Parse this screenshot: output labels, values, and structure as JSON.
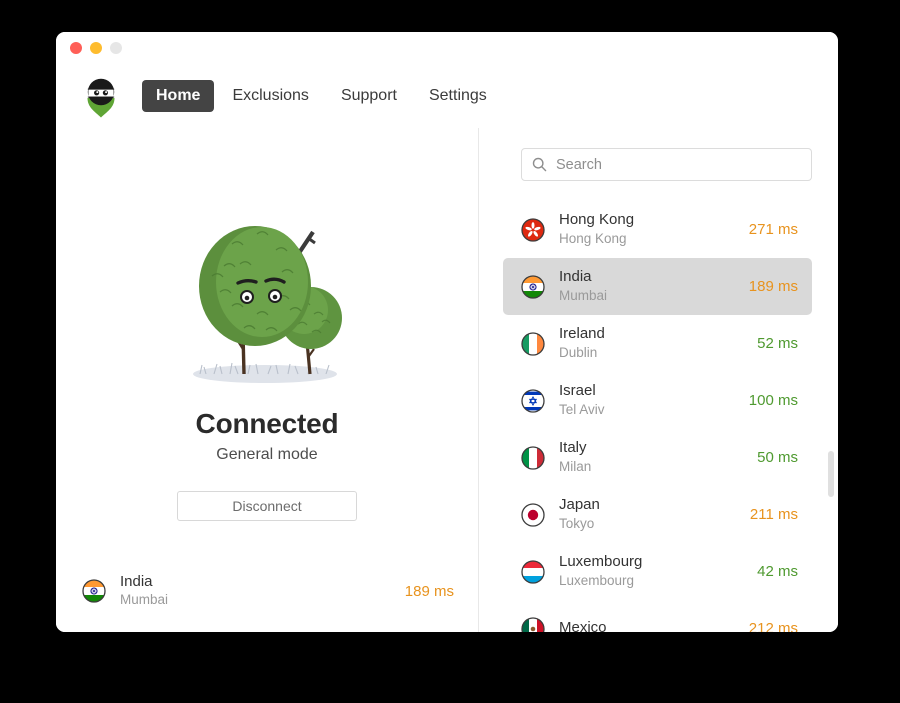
{
  "window": {
    "traffic_lights": [
      "close",
      "minimize",
      "maximize"
    ]
  },
  "nav": {
    "logo_name": "ninja-logo",
    "items": [
      {
        "label": "Home",
        "active": true
      },
      {
        "label": "Exclusions",
        "active": false
      },
      {
        "label": "Support",
        "active": false
      },
      {
        "label": "Settings",
        "active": false
      }
    ]
  },
  "connection": {
    "illustration_name": "ninja-bush-illustration",
    "status": "Connected",
    "mode": "General mode",
    "button_label": "Disconnect",
    "current_server": {
      "country": "India",
      "city": "Mumbai",
      "ping": "189 ms",
      "ping_level": "high",
      "flag": "flag-in"
    }
  },
  "search": {
    "placeholder": "Search",
    "value": "",
    "icon": "search-icon"
  },
  "servers": [
    {
      "country": "Hong Kong",
      "city": "Hong Kong",
      "ping": "271 ms",
      "ping_level": "high",
      "flag": "flag-hk",
      "selected": false
    },
    {
      "country": "India",
      "city": "Mumbai",
      "ping": "189 ms",
      "ping_level": "high",
      "flag": "flag-in",
      "selected": true
    },
    {
      "country": "Ireland",
      "city": "Dublin",
      "ping": "52 ms",
      "ping_level": "low",
      "flag": "flag-ie",
      "selected": false
    },
    {
      "country": "Israel",
      "city": "Tel Aviv",
      "ping": "100 ms",
      "ping_level": "low",
      "flag": "flag-il",
      "selected": false
    },
    {
      "country": "Italy",
      "city": "Milan",
      "ping": "50 ms",
      "ping_level": "low",
      "flag": "flag-it",
      "selected": false
    },
    {
      "country": "Japan",
      "city": "Tokyo",
      "ping": "211 ms",
      "ping_level": "high",
      "flag": "flag-jp",
      "selected": false
    },
    {
      "country": "Luxembourg",
      "city": "Luxembourg",
      "ping": "42 ms",
      "ping_level": "low",
      "flag": "flag-lu",
      "selected": false
    },
    {
      "country": "Mexico",
      "city": "",
      "ping": "212 ms",
      "ping_level": "high",
      "flag": "flag-mx",
      "selected": false
    }
  ],
  "colors": {
    "ping_high": "#e8931e",
    "ping_low": "#4f9a30",
    "nav_active_bg": "#444444",
    "selected_row_bg": "#d9d9d9",
    "brand_green": "#5fa535"
  },
  "scrollbar": {
    "name": "server-list-scrollbar"
  }
}
